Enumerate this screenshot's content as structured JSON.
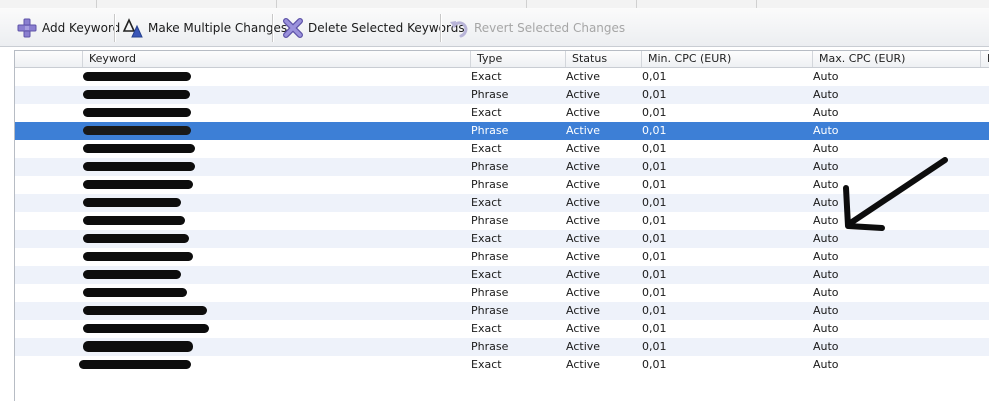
{
  "toolbar": {
    "add_keyword": "Add Keyword",
    "make_multiple_changes": "Make Multiple Changes",
    "delete_selected": "Delete Selected Keywords",
    "revert_selected": "Revert Selected Changes"
  },
  "table": {
    "columns": [
      "Keyword",
      "Type",
      "Status",
      "Min. CPC (EUR)",
      "Max. CPC (EUR)",
      "D"
    ],
    "rows": [
      {
        "type": "Exact",
        "status": "Active",
        "min_cpc": "0,01",
        "max_cpc": "Auto"
      },
      {
        "type": "Phrase",
        "status": "Active",
        "min_cpc": "0,01",
        "max_cpc": "Auto"
      },
      {
        "type": "Exact",
        "status": "Active",
        "min_cpc": "0,01",
        "max_cpc": "Auto"
      },
      {
        "type": "Phrase",
        "status": "Active",
        "min_cpc": "0,01",
        "max_cpc": "Auto"
      },
      {
        "type": "Exact",
        "status": "Active",
        "min_cpc": "0,01",
        "max_cpc": "Auto"
      },
      {
        "type": "Phrase",
        "status": "Active",
        "min_cpc": "0,01",
        "max_cpc": "Auto"
      },
      {
        "type": "Phrase",
        "status": "Active",
        "min_cpc": "0,01",
        "max_cpc": "Auto"
      },
      {
        "type": "Exact",
        "status": "Active",
        "min_cpc": "0,01",
        "max_cpc": "Auto"
      },
      {
        "type": "Phrase",
        "status": "Active",
        "min_cpc": "0,01",
        "max_cpc": "Auto"
      },
      {
        "type": "Exact",
        "status": "Active",
        "min_cpc": "0,01",
        "max_cpc": "Auto"
      },
      {
        "type": "Phrase",
        "status": "Active",
        "min_cpc": "0,01",
        "max_cpc": "Auto"
      },
      {
        "type": "Exact",
        "status": "Active",
        "min_cpc": "0,01",
        "max_cpc": "Auto"
      },
      {
        "type": "Phrase",
        "status": "Active",
        "min_cpc": "0,01",
        "max_cpc": "Auto"
      },
      {
        "type": "Phrase",
        "status": "Active",
        "min_cpc": "0,01",
        "max_cpc": "Auto"
      },
      {
        "type": "Exact",
        "status": "Active",
        "min_cpc": "0,01",
        "max_cpc": "Auto"
      },
      {
        "type": "Phrase",
        "status": "Active",
        "min_cpc": "0,01",
        "max_cpc": "Auto"
      },
      {
        "type": "Exact",
        "status": "Active",
        "min_cpc": "0,01",
        "max_cpc": "Auto"
      }
    ],
    "selected_row": 3
  },
  "icons": {
    "add": "plus-icon",
    "multi": "delta-icon",
    "delete": "x-icon",
    "revert": "undo-icon"
  },
  "colors": {
    "selection": "#3d7fd6",
    "alt_row": "#eef2fa",
    "annotation_arrow": "#0d0d0d"
  }
}
